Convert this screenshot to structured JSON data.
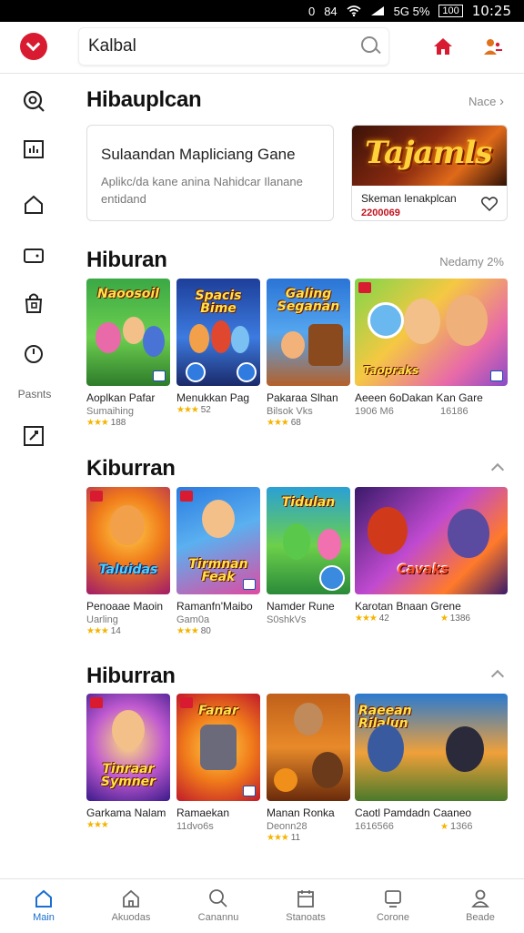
{
  "status": {
    "left": "0",
    "notif": "84",
    "signal": "5G 5%",
    "battery": "100",
    "time": "10:25"
  },
  "search": {
    "value": "Kalbal"
  },
  "sidebar": {
    "label": "Pasnts"
  },
  "featured_section": {
    "title": "Hibauplcan",
    "more": "Nace"
  },
  "featured_card": {
    "title": "Sulaandan Mapliciang Gane",
    "desc": "Aplikc/da kane anina Nahidcar Ilanane entidand"
  },
  "promo_card": {
    "banner": "Tajamls",
    "title": "Skeman lenakplcan",
    "price": "2200069"
  },
  "sections": [
    {
      "title": "Hiburan",
      "more": "Nedamy 2%",
      "items": [
        {
          "name": "Aoplkan Pafar",
          "sub": "Sumaihing",
          "rating": "188"
        },
        {
          "name": "Menukkan Pag",
          "sub": "",
          "rating": "52"
        },
        {
          "name": "Pakaraa Slhan",
          "sub": "Bilsok Vks",
          "rating": "68"
        },
        {
          "name": "Aeeen 6oDakan Kan Gare",
          "sub": "1906 M6",
          "rating": "16186"
        }
      ]
    },
    {
      "title": "Kiburran",
      "items": [
        {
          "name": "Penoaae Maoin",
          "sub": "Uarling",
          "rating": "14"
        },
        {
          "name": "Ramanfn'Maibo",
          "sub": "Gam0a",
          "rating": "80"
        },
        {
          "name": "Namder Rune",
          "sub": "S0shkVs",
          "rating": ""
        },
        {
          "name": "Karotan Bnaan Grene",
          "sub": "",
          "rating": "42"
        }
      ]
    },
    {
      "title": "Hiburran",
      "items": [
        {
          "name": "Garkama Nalam",
          "sub": "",
          "rating": ""
        },
        {
          "name": "Ramaekan",
          "sub": "11dvo6s",
          "rating": ""
        },
        {
          "name": "Manan Ronka",
          "sub": "Deonn28",
          "rating": "11"
        },
        {
          "name": "Caotl Pamdadn Caaneo",
          "sub": "1616566",
          "rating": ""
        }
      ]
    }
  ],
  "extra_ratings": {
    "s2_last": "1386",
    "s3_last": "1366"
  },
  "art_text": {
    "s1": [
      "Naoosoil",
      "Spacis Bime",
      "Galing Seganan",
      "Taopraks"
    ],
    "s2": [
      "Taluidas",
      "Tirmnan Feak",
      "Tidulan",
      "Cavaks"
    ],
    "s3": [
      "Tinraar Symner",
      "Fanar",
      "",
      "Raeean Rilalun"
    ]
  },
  "bottom_nav": [
    {
      "label": "Main",
      "icon": "home-icon"
    },
    {
      "label": "Akuodas",
      "icon": "house-outline-icon"
    },
    {
      "label": "Canannu",
      "icon": "search-icon"
    },
    {
      "label": "Stanoats",
      "icon": "calendar-icon"
    },
    {
      "label": "Corone",
      "icon": "monitor-icon"
    },
    {
      "label": "Beade",
      "icon": "person-icon"
    }
  ],
  "colors": {
    "accent": "#d81b30",
    "nav_active": "#1a6fd1",
    "star": "#f4b400"
  }
}
